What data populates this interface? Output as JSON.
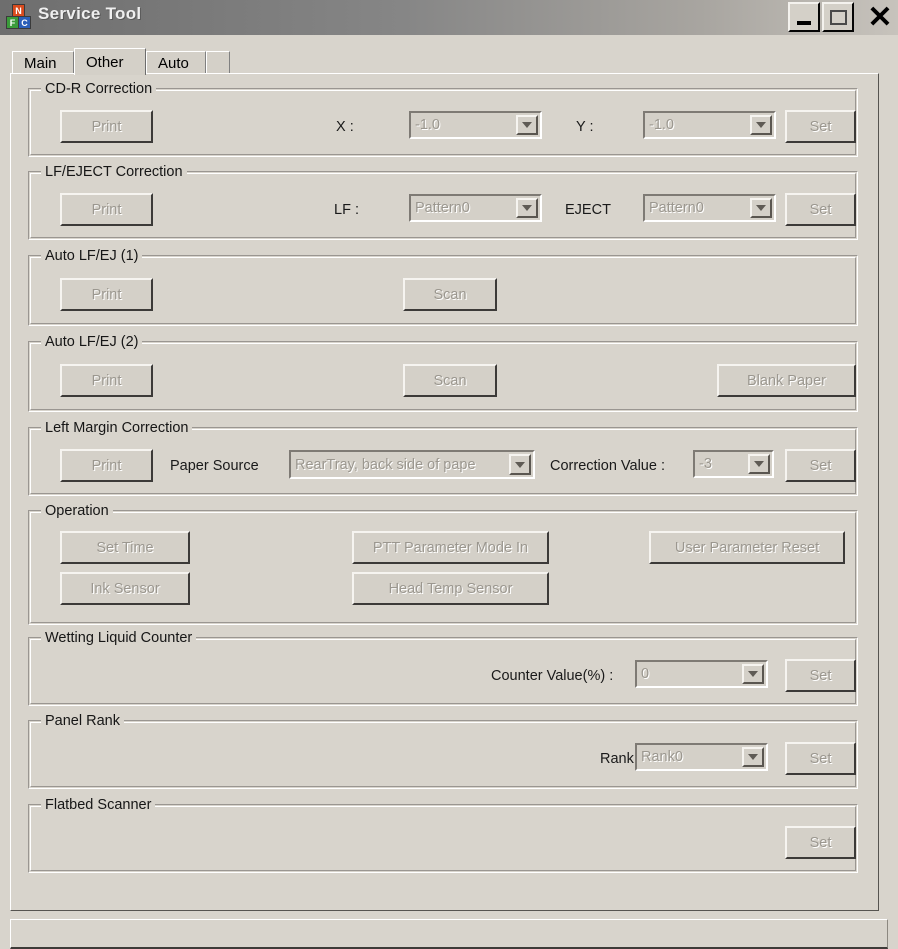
{
  "window": {
    "title": "Service Tool",
    "icon": "app-blocks-icon",
    "controls": {
      "minimize": "minimize-icon",
      "maximize": "maximize-icon",
      "close": "✕"
    }
  },
  "tabs": [
    {
      "label": "Main",
      "selected": false
    },
    {
      "label": "Other",
      "selected": true
    },
    {
      "label": "Auto",
      "selected": false
    }
  ],
  "groups": {
    "cdr": {
      "title": "CD-R Correction",
      "print_label": "Print",
      "x_label": "X :",
      "x_value": "-1.0",
      "y_label": "Y :",
      "y_value": "-1.0",
      "set_label": "Set"
    },
    "lfeject": {
      "title": "LF/EJECT Correction",
      "print_label": "Print",
      "lf_label": "LF :",
      "lf_value": "Pattern0",
      "eject_label": "EJECT",
      "eject_value": "Pattern0",
      "set_label": "Set"
    },
    "auto1": {
      "title": "Auto LF/EJ (1)",
      "print_label": "Print",
      "scan_label": "Scan"
    },
    "auto2": {
      "title": "Auto LF/EJ (2)",
      "print_label": "Print",
      "scan_label": "Scan",
      "blank_label": "Blank Paper"
    },
    "leftmargin": {
      "title": "Left Margin Correction",
      "print_label": "Print",
      "paper_source_label": "Paper Source",
      "paper_source_value": "RearTray, back side of pape",
      "correction_label": "Correction Value :",
      "correction_value": "-3",
      "set_label": "Set"
    },
    "operation": {
      "title": "Operation",
      "set_time_label": "Set Time",
      "ink_sensor_label": "Ink Sensor",
      "ptt_label": "PTT Parameter Mode In",
      "head_temp_label": "Head Temp Sensor",
      "user_reset_label": "User Parameter Reset"
    },
    "wetting": {
      "title": "Wetting Liquid Counter",
      "counter_label": "Counter Value(%) :",
      "counter_value": "0",
      "set_label": "Set"
    },
    "panelrank": {
      "title": "Panel Rank",
      "rank_label": "Rank :",
      "rank_value": "Rank0",
      "set_label": "Set"
    },
    "flatbed": {
      "title": "Flatbed Scanner",
      "set_label": "Set"
    }
  },
  "colors": {
    "face": "#d8d4cc",
    "button_face": "#d4d0c8",
    "disabled_text": "#9b978f",
    "title_bar_start": "#6e6e6e",
    "title_bar_end": "#c7c3bc"
  }
}
